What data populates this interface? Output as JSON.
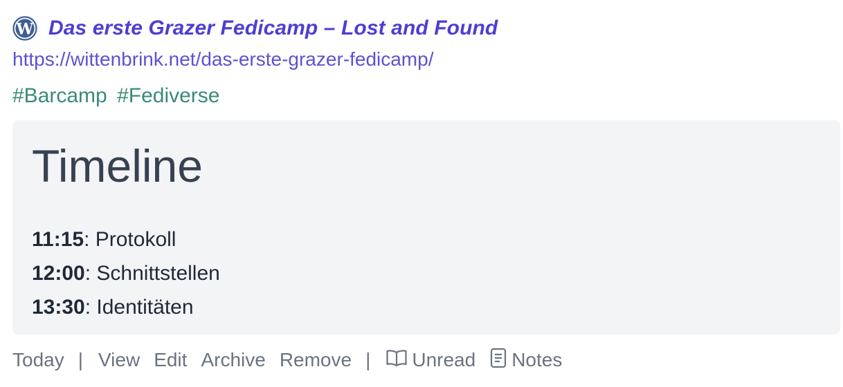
{
  "bookmark": {
    "favicon": "wordpress-icon",
    "title": "Das erste Grazer Fedicamp – Lost and Found",
    "url": "https://wittenbrink.net/das-erste-grazer-fedicamp/",
    "tags": [
      "#Barcamp",
      "#Fediverse"
    ],
    "description": {
      "heading": "Timeline",
      "items": [
        {
          "time": "11:15",
          "text": ": Protokoll"
        },
        {
          "time": "12:00",
          "text": ": Schnittstellen"
        },
        {
          "time": "13:30",
          "text": ": Identitäten"
        }
      ]
    },
    "actions": {
      "date_label": "Today",
      "separator": "|",
      "view": "View",
      "edit": "Edit",
      "archive": "Archive",
      "remove": "Remove",
      "unread": "Unread",
      "unread_icon": "book-open-icon",
      "notes": "Notes",
      "notes_icon": "document-icon"
    }
  },
  "colors": {
    "title": "#4c3fd1",
    "url": "#5b52d0",
    "tag": "#3a8a78",
    "description_bg": "#f3f4f6",
    "muted_text": "#6b7280"
  }
}
